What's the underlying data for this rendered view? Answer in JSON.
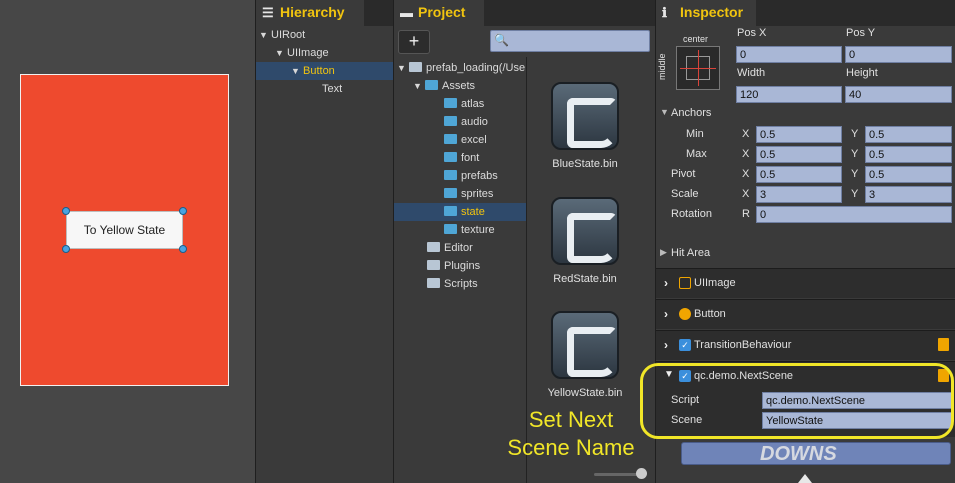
{
  "scene": {
    "button_label": "To Yellow State"
  },
  "hierarchy": {
    "tab": "Hierarchy",
    "items": [
      {
        "label": "UIRoot",
        "level": 0,
        "expanded": true
      },
      {
        "label": "UIImage",
        "level": 1,
        "expanded": true
      },
      {
        "label": "Button",
        "level": 2,
        "expanded": true,
        "selected": true
      },
      {
        "label": "Text",
        "level": 3
      }
    ]
  },
  "project": {
    "tab": "Project",
    "add_label": "+",
    "search_placeholder": "",
    "tree": [
      {
        "label": "prefab_loading(/Use"
      },
      {
        "label": "Assets"
      },
      {
        "label": "atlas"
      },
      {
        "label": "audio"
      },
      {
        "label": "excel"
      },
      {
        "label": "font"
      },
      {
        "label": "prefabs"
      },
      {
        "label": "sprites"
      },
      {
        "label": "state",
        "selected": true
      },
      {
        "label": "texture"
      },
      {
        "label": "Editor"
      },
      {
        "label": "Plugins"
      },
      {
        "label": "Scripts"
      }
    ],
    "assets": [
      {
        "label": "BlueState.bin"
      },
      {
        "label": "RedState.bin"
      },
      {
        "label": "YellowState.bin"
      }
    ],
    "annotation": "Set Next Scene Name"
  },
  "inspector": {
    "tab": "Inspector",
    "anchor_box": {
      "top": "center",
      "side": "middle"
    },
    "labels": {
      "pos_x": "Pos X",
      "pos_y": "Pos Y",
      "width": "Width",
      "height": "Height",
      "anchors": "Anchors",
      "min": "Min",
      "max": "Max",
      "pivot": "Pivot",
      "scale": "Scale",
      "rotation": "Rotation",
      "x": "X",
      "y": "Y",
      "r": "R",
      "hit_area": "Hit Area",
      "script": "Script",
      "scene": "Scene"
    },
    "values": {
      "pos_x": "0",
      "pos_y": "0",
      "width": "120",
      "height": "40",
      "min_x": "0.5",
      "min_y": "0.5",
      "max_x": "0.5",
      "max_y": "0.5",
      "pivot_x": "0.5",
      "pivot_y": "0.5",
      "scale_x": "3",
      "scale_y": "3",
      "rotation": "0"
    },
    "components": {
      "uiimage": "UIImage",
      "button": "Button",
      "transition": "TransitionBehaviour",
      "nextscene": "qc.demo.NextScene"
    },
    "script_value": "qc.demo.NextScene",
    "scene_value": "YellowState"
  },
  "watermark": "DOWNS"
}
